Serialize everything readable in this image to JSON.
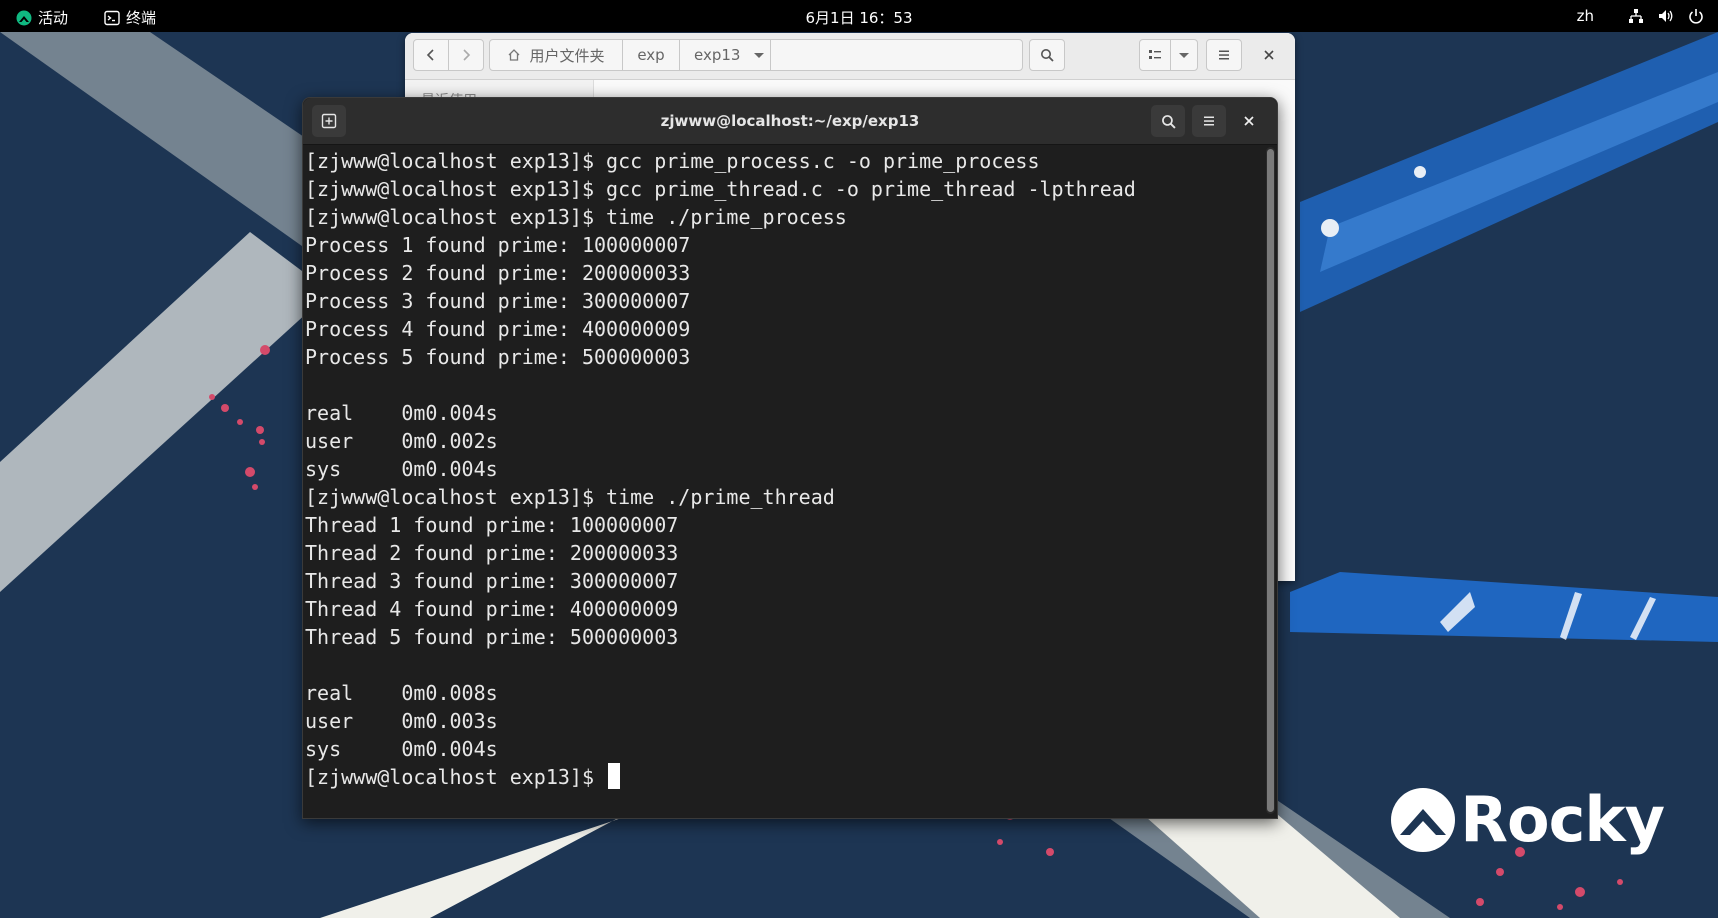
{
  "topbar": {
    "activities_label": "活动",
    "app_label": "终端",
    "clock": "6月1日 16：53",
    "language": "zh",
    "icons": [
      "network-icon",
      "volume-icon",
      "power-icon"
    ]
  },
  "file_manager": {
    "breadcrumbs": [
      {
        "label": "用户文件夹",
        "icon": "home-icon"
      },
      {
        "label": "exp"
      },
      {
        "label": "exp13"
      }
    ],
    "sidebar_partial_label": "最近使用"
  },
  "terminal": {
    "title": "zjwww@localhost:~/exp/exp13",
    "lines": [
      "[zjwww@localhost exp13]$ gcc prime_process.c -o prime_process",
      "[zjwww@localhost exp13]$ gcc prime_thread.c -o prime_thread -lpthread",
      "[zjwww@localhost exp13]$ time ./prime_process",
      "Process 1 found prime: 100000007",
      "Process 2 found prime: 200000033",
      "Process 3 found prime: 300000007",
      "Process 4 found prime: 400000009",
      "Process 5 found prime: 500000003",
      "",
      "real    0m0.004s",
      "user    0m0.002s",
      "sys     0m0.004s",
      "[zjwww@localhost exp13]$ time ./prime_thread",
      "Thread 1 found prime: 100000007",
      "Thread 2 found prime: 200000033",
      "Thread 3 found prime: 300000007",
      "Thread 4 found prime: 400000009",
      "Thread 5 found prime: 500000003",
      "",
      "real    0m0.008s",
      "user    0m0.003s",
      "sys     0m0.004s"
    ],
    "prompt": "[zjwww@localhost exp13]$ "
  },
  "wallpaper": {
    "logo_text": "Rocky",
    "colors": {
      "background": "#1d3553",
      "stripe": "#e6e7e0",
      "accent": "#1f5fb0",
      "speckle": "#d44a6a"
    }
  },
  "colors": {
    "terminal_bg": "#1e1e1e",
    "terminal_header": "#2d2d2d",
    "terminal_text": "#e8e8e8",
    "topbar_bg": "#000000",
    "rocky_green": "#10b981"
  }
}
